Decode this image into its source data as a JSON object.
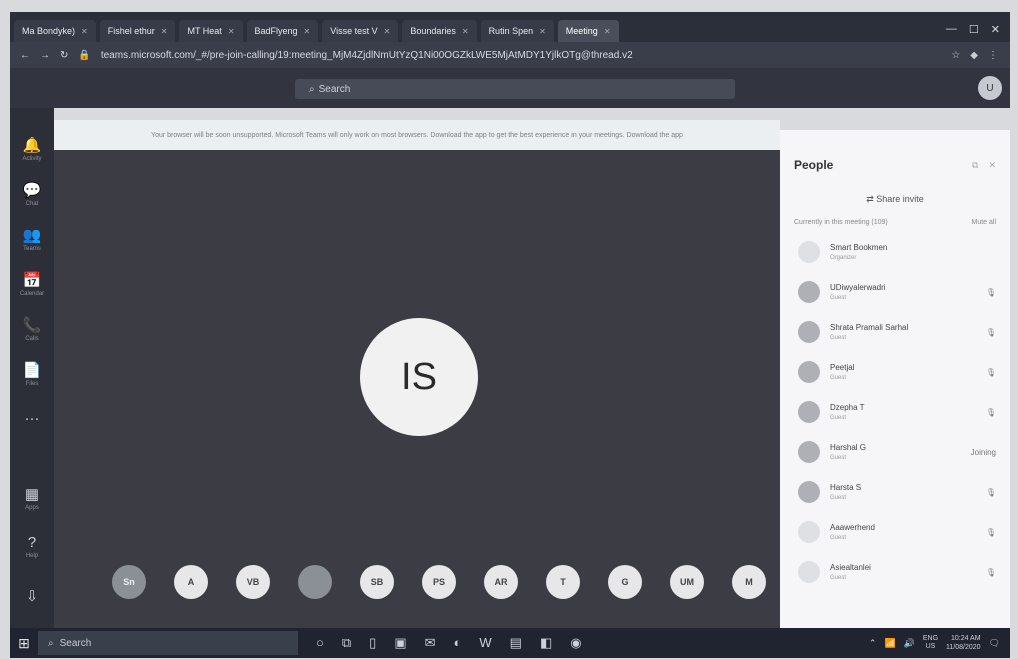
{
  "browser": {
    "tabs": [
      {
        "label": "Ma Bondyke)",
        "active": false
      },
      {
        "label": "Fishel ethur",
        "active": false
      },
      {
        "label": "MT Heat",
        "active": false
      },
      {
        "label": "BadFlyeng",
        "active": false
      },
      {
        "label": "Visse test V",
        "active": false
      },
      {
        "label": "Boundaries",
        "active": false
      },
      {
        "label": "Rutin Spen",
        "active": false
      },
      {
        "label": "Meeting",
        "active": true
      }
    ],
    "url": "teams.microsoft.com/_#/pre-join-calling/19:meeting_MjM4ZjdlNmUtYzQ1Ni00OGZkLWE5MjAtMDY1YjlkOTg@thread.v2"
  },
  "teams": {
    "search_placeholder": "Search",
    "profile_initials": "U"
  },
  "rail": [
    {
      "icon": "bell-icon",
      "glyph": "🔔",
      "label": "Activity"
    },
    {
      "icon": "chat-icon",
      "glyph": "💬",
      "label": "Chat"
    },
    {
      "icon": "teams-icon",
      "glyph": "👥",
      "label": "Teams"
    },
    {
      "icon": "calendar-icon",
      "glyph": "📅",
      "label": "Calendar"
    },
    {
      "icon": "calls-icon",
      "glyph": "📞",
      "label": "Calls"
    },
    {
      "icon": "files-icon",
      "glyph": "📄",
      "label": "Files"
    },
    {
      "icon": "more-icon",
      "glyph": "···",
      "label": ""
    }
  ],
  "rail_bottom": [
    {
      "icon": "apps-icon",
      "glyph": "▦",
      "label": "Apps"
    },
    {
      "icon": "help-icon",
      "glyph": "?",
      "label": "Help"
    },
    {
      "icon": "download-icon",
      "glyph": "⇩",
      "label": ""
    }
  ],
  "banner": {
    "text": "Your browser will be soon unsupported. Microsoft Teams will only work on most browsers. Download the app to get the best experience in your meetings. Download the app"
  },
  "stage": {
    "presenter_initials": "IS",
    "participants": [
      {
        "initials": "Sn",
        "dark": true
      },
      {
        "initials": "A",
        "dark": false
      },
      {
        "initials": "VB",
        "dark": false
      },
      {
        "initials": "",
        "dark": true
      },
      {
        "initials": "SB",
        "dark": false
      },
      {
        "initials": "PS",
        "dark": false
      },
      {
        "initials": "AR",
        "dark": false
      },
      {
        "initials": "T",
        "dark": false
      },
      {
        "initials": "G",
        "dark": false
      },
      {
        "initials": "UM",
        "dark": false
      },
      {
        "initials": "M",
        "dark": false
      }
    ]
  },
  "people": {
    "title": "People",
    "share_invite": "Share invite",
    "section_label": "Currently in this meeting (109)",
    "mute_all": "Mute all",
    "members": [
      {
        "name": "Smart Bookmen",
        "role": "Organizer",
        "state": "",
        "light": true
      },
      {
        "name": "UDiwyalerwadri",
        "role": "Guest",
        "state": "🎙",
        "light": false
      },
      {
        "name": "Shrata Pramali Sarhal",
        "role": "Guest",
        "state": "🎙",
        "light": false
      },
      {
        "name": "Peetjal",
        "role": "Guest",
        "state": "🎙",
        "light": false
      },
      {
        "name": "Dzepha T",
        "role": "Guest",
        "state": "🎙",
        "light": false
      },
      {
        "name": "Harshal G",
        "role": "Guest",
        "state": "Joining",
        "light": false
      },
      {
        "name": "Harsta S",
        "role": "Guest",
        "state": "🎙",
        "light": false
      },
      {
        "name": "Aaawerhend",
        "role": "Guest",
        "state": "🎙",
        "light": true
      },
      {
        "name": "Asiealtanlei",
        "role": "Guest",
        "state": "🎙",
        "light": true
      }
    ]
  },
  "taskbar": {
    "search_placeholder": "Search",
    "lang": [
      "ENG",
      "US"
    ],
    "time": "10:24 AM",
    "date": "11/08/2020"
  }
}
